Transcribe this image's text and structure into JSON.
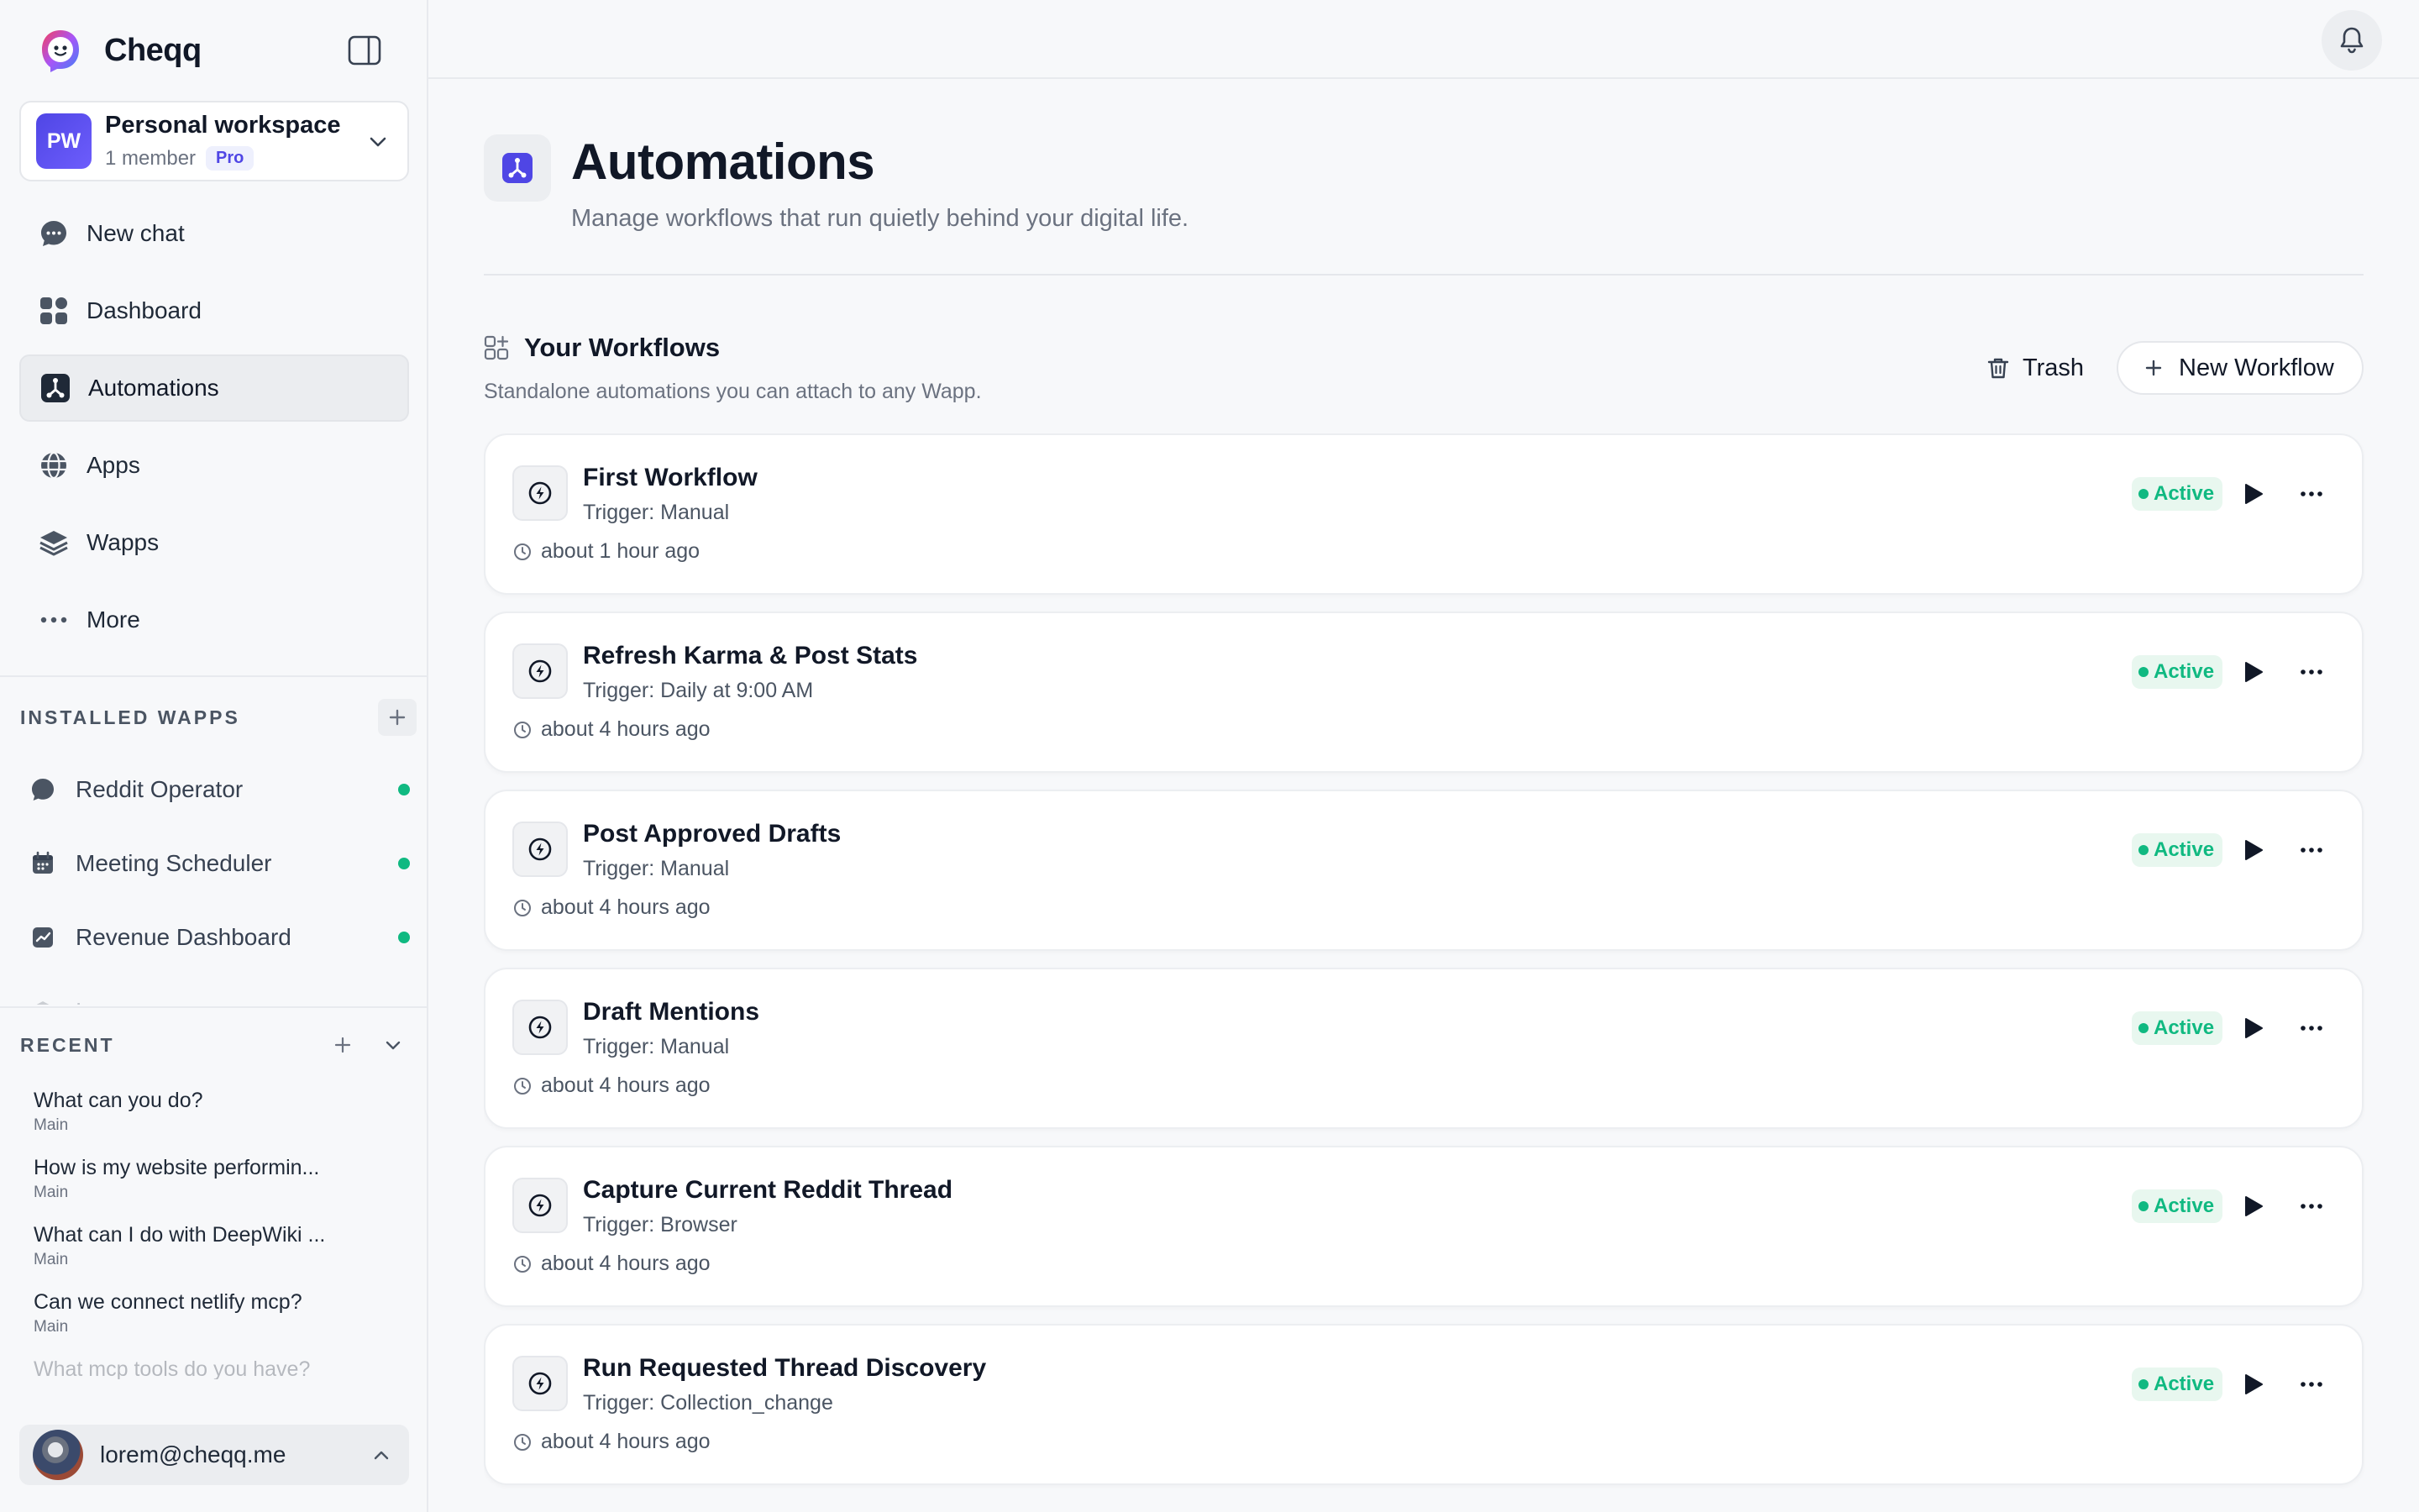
{
  "brand": {
    "name": "Cheqq"
  },
  "workspace": {
    "initials": "PW",
    "name": "Personal workspace",
    "members": "1 member",
    "plan": "Pro"
  },
  "nav": [
    {
      "label": "New chat",
      "icon": "chat-bubble-icon",
      "active": false
    },
    {
      "label": "Dashboard",
      "icon": "dashboard-grid-icon",
      "active": false
    },
    {
      "label": "Automations",
      "icon": "automations-icon",
      "active": true
    },
    {
      "label": "Apps",
      "icon": "globe-icon",
      "active": false
    },
    {
      "label": "Wapps",
      "icon": "layers-icon",
      "active": false
    },
    {
      "label": "More",
      "icon": "more-dots-icon",
      "active": false
    }
  ],
  "installed": {
    "title": "INSTALLED WAPPS",
    "items": [
      {
        "label": "Reddit Operator",
        "icon": "reddit-icon"
      },
      {
        "label": "Meeting Scheduler",
        "icon": "calendar-icon"
      },
      {
        "label": "Revenue Dashboard",
        "icon": "chart-icon"
      },
      {
        "label": "Lorem",
        "icon": "layers-icon"
      }
    ]
  },
  "recent": {
    "title": "RECENT",
    "items": [
      {
        "title": "What can you do?",
        "sub": "Main"
      },
      {
        "title": "How is my website performin...",
        "sub": "Main"
      },
      {
        "title": "What can I do with DeepWiki ...",
        "sub": "Main"
      },
      {
        "title": "Can we connect netlify mcp?",
        "sub": "Main"
      },
      {
        "title": "What mcp tools do you have?",
        "sub": ""
      }
    ]
  },
  "user": {
    "email": "lorem@cheqq.me"
  },
  "page": {
    "title": "Automations",
    "subtitle": "Manage workflows that run quietly behind your digital life."
  },
  "workflows": {
    "title": "Your Workflows",
    "subtitle": "Standalone automations you can attach to any Wapp.",
    "trash_label": "Trash",
    "new_label": "New Workflow",
    "items": [
      {
        "name": "First Workflow",
        "trigger": "Trigger: Manual",
        "time": "about 1 hour ago",
        "status": "Active"
      },
      {
        "name": "Refresh Karma & Post Stats",
        "trigger": "Trigger: Daily at 9:00 AM",
        "time": "about 4 hours ago",
        "status": "Active"
      },
      {
        "name": "Post Approved Drafts",
        "trigger": "Trigger: Manual",
        "time": "about 4 hours ago",
        "status": "Active"
      },
      {
        "name": "Draft Mentions",
        "trigger": "Trigger: Manual",
        "time": "about 4 hours ago",
        "status": "Active"
      },
      {
        "name": "Capture Current Reddit Thread",
        "trigger": "Trigger: Browser",
        "time": "about 4 hours ago",
        "status": "Active"
      },
      {
        "name": "Run Requested Thread Discovery",
        "trigger": "Trigger: Collection_change",
        "time": "about 4 hours ago",
        "status": "Active"
      }
    ]
  },
  "colors": {
    "accent": "#4f46e5",
    "active": "#10b981",
    "active_bg": "#e8f7ef"
  }
}
